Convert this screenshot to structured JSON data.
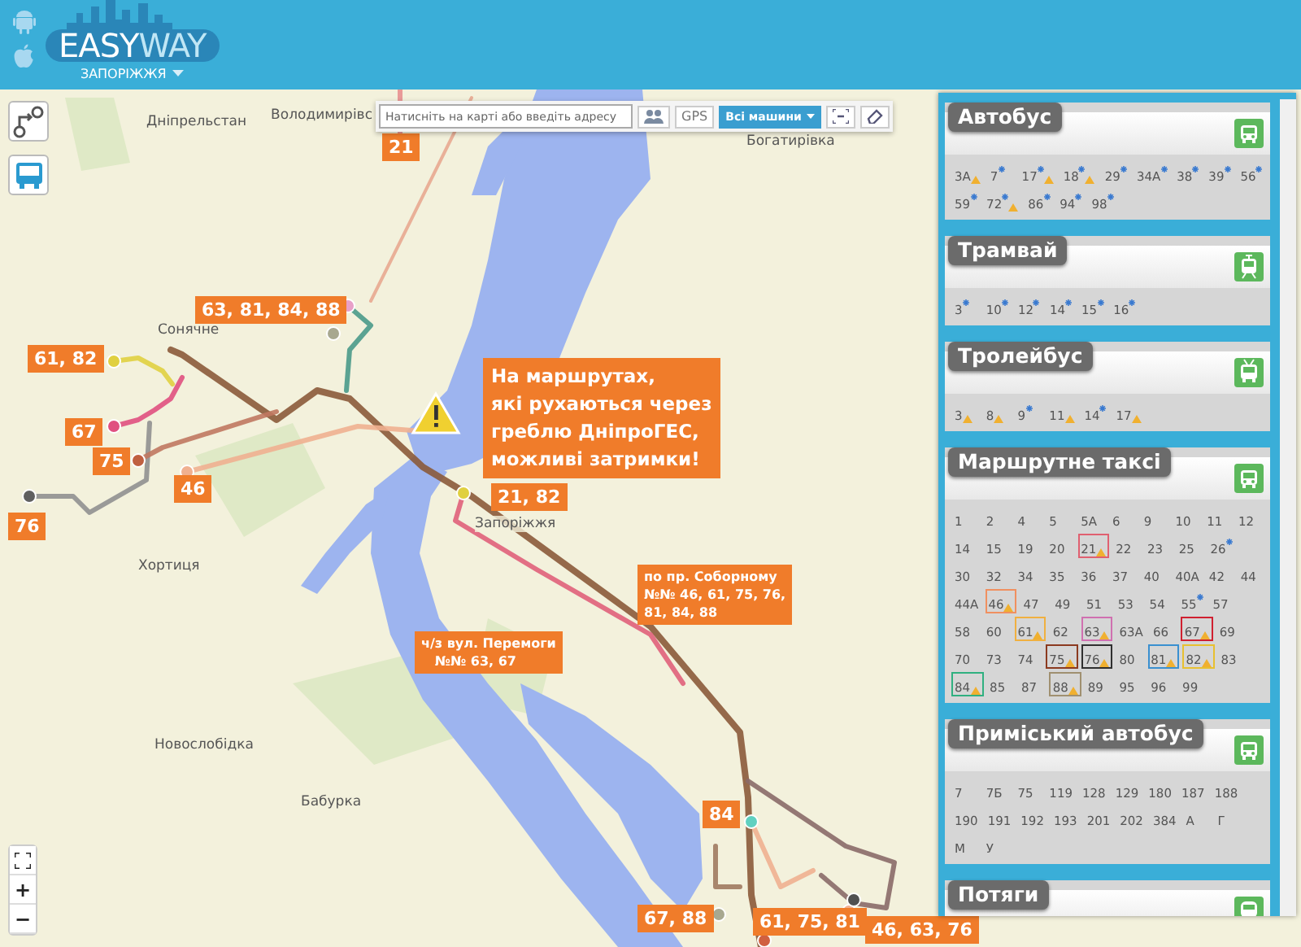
{
  "header": {
    "logo": [
      "EASY",
      "WAY"
    ],
    "city": "ЗАПОРІЖЖЯ"
  },
  "search": {
    "placeholder": "Натисніть на карті або введіть адресу",
    "gps": "GPS",
    "vehicles": "Всі машини"
  },
  "zoom": {
    "plus": "+",
    "minus": "−"
  },
  "map": {
    "places": [
      "Дніпрельстан",
      "Володимирівс",
      "Богатирівка",
      "Сонячне",
      "Хортиця",
      "Запоріжжя",
      "Новослобідка",
      "Бабурка"
    ],
    "route_labels": [
      "21",
      "63, 81, 84, 88",
      "61, 82",
      "67",
      "75",
      "46",
      "76",
      "21, 82",
      "84",
      "67, 88",
      "61, 75, 81",
      "46, 63, 76"
    ],
    "notes": [
      "по пр. Соборному\n№№ 46, 61, 75, 76,\n81, 84, 88",
      "ч/з вул. Перемоги\n   №№ 63, 67"
    ],
    "warning": "На маршрутах,\nякі рухаються через\nгреблю ДніпроГЕС,\nможливі затримки!"
  },
  "panel": {
    "sections": [
      {
        "title": "Автобус",
        "kind": "bus",
        "routes": [
          {
            "label": "3A",
            "star": false,
            "warning": true
          },
          {
            "label": "7",
            "star": true,
            "warning": false
          },
          {
            "label": "17",
            "star": true,
            "warning": true
          },
          {
            "label": "18",
            "star": true,
            "warning": true
          },
          {
            "label": "29",
            "star": true,
            "warning": false
          },
          {
            "label": "34A",
            "star": true,
            "warning": false
          },
          {
            "label": "38",
            "star": true,
            "warning": false
          },
          {
            "label": "39",
            "star": true,
            "warning": false
          },
          {
            "label": "56",
            "star": true,
            "warning": false
          },
          {
            "label": "59",
            "star": true,
            "warning": false
          },
          {
            "label": "72",
            "star": true,
            "warning": true
          },
          {
            "label": "86",
            "star": true,
            "warning": false
          },
          {
            "label": "94",
            "star": true,
            "warning": false
          },
          {
            "label": "98",
            "star": true,
            "warning": false
          }
        ]
      },
      {
        "title": "Трамвай",
        "kind": "tram",
        "routes": [
          {
            "label": "3",
            "star": true,
            "warning": false
          },
          {
            "label": "10",
            "star": true,
            "warning": false
          },
          {
            "label": "12",
            "star": true,
            "warning": false
          },
          {
            "label": "14",
            "star": true,
            "warning": false
          },
          {
            "label": "15",
            "star": true,
            "warning": false
          },
          {
            "label": "16",
            "star": true,
            "warning": false
          }
        ]
      },
      {
        "title": "Тролейбус",
        "kind": "trolleybus",
        "routes": [
          {
            "label": "3",
            "star": false,
            "warning": true
          },
          {
            "label": "8",
            "star": false,
            "warning": true
          },
          {
            "label": "9",
            "star": true,
            "warning": false
          },
          {
            "label": "11",
            "star": false,
            "warning": true
          },
          {
            "label": "14",
            "star": true,
            "warning": false
          },
          {
            "label": "17",
            "star": false,
            "warning": true
          }
        ]
      },
      {
        "title": "Маршрутне таксі",
        "kind": "bus",
        "routes": [
          {
            "label": "1",
            "star": false,
            "warning": false
          },
          {
            "label": "2",
            "star": false,
            "warning": false
          },
          {
            "label": "4",
            "star": false,
            "warning": false
          },
          {
            "label": "5",
            "star": false,
            "warning": false
          },
          {
            "label": "5A",
            "star": false,
            "warning": false
          },
          {
            "label": "6",
            "star": false,
            "warning": false
          },
          {
            "label": "9",
            "star": false,
            "warning": false
          },
          {
            "label": "10",
            "star": false,
            "warning": false
          },
          {
            "label": "11",
            "star": false,
            "warning": false
          },
          {
            "label": "12",
            "star": false,
            "warning": false
          },
          {
            "label": "14",
            "star": false,
            "warning": false
          },
          {
            "label": "15",
            "star": false,
            "warning": false
          },
          {
            "label": "19",
            "star": false,
            "warning": false
          },
          {
            "label": "20",
            "star": false,
            "warning": false
          },
          {
            "label": "21",
            "star": false,
            "warning": true,
            "color": "#e06070"
          },
          {
            "label": "22",
            "star": false,
            "warning": false
          },
          {
            "label": "23",
            "star": false,
            "warning": false
          },
          {
            "label": "25",
            "star": false,
            "warning": false
          },
          {
            "label": "26",
            "star": true,
            "warning": false
          },
          {
            "label": "30",
            "star": false,
            "warning": false
          },
          {
            "label": "32",
            "star": false,
            "warning": false
          },
          {
            "label": "34",
            "star": false,
            "warning": false
          },
          {
            "label": "35",
            "star": false,
            "warning": false
          },
          {
            "label": "36",
            "star": false,
            "warning": false
          },
          {
            "label": "37",
            "star": false,
            "warning": false
          },
          {
            "label": "40",
            "star": false,
            "warning": false
          },
          {
            "label": "40A",
            "star": false,
            "warning": false
          },
          {
            "label": "42",
            "star": false,
            "warning": false
          },
          {
            "label": "44",
            "star": false,
            "warning": false
          },
          {
            "label": "44A",
            "star": false,
            "warning": false
          },
          {
            "label": "46",
            "star": false,
            "warning": true,
            "color": "#f09060"
          },
          {
            "label": "47",
            "star": false,
            "warning": false
          },
          {
            "label": "49",
            "star": false,
            "warning": false
          },
          {
            "label": "51",
            "star": false,
            "warning": false
          },
          {
            "label": "53",
            "star": false,
            "warning": false
          },
          {
            "label": "54",
            "star": false,
            "warning": false
          },
          {
            "label": "55",
            "star": true,
            "warning": false
          },
          {
            "label": "57",
            "star": false,
            "warning": false
          },
          {
            "label": "58",
            "star": false,
            "warning": false
          },
          {
            "label": "60",
            "star": false,
            "warning": false
          },
          {
            "label": "61",
            "star": false,
            "warning": true,
            "color": "#f0b040"
          },
          {
            "label": "62",
            "star": false,
            "warning": false
          },
          {
            "label": "63",
            "star": false,
            "warning": true,
            "color": "#d070b0"
          },
          {
            "label": "63A",
            "star": false,
            "warning": false
          },
          {
            "label": "66",
            "star": false,
            "warning": false
          },
          {
            "label": "67",
            "star": false,
            "warning": true,
            "color": "#d02030"
          },
          {
            "label": "69",
            "star": false,
            "warning": false
          },
          {
            "label": "70",
            "star": false,
            "warning": false
          },
          {
            "label": "73",
            "star": false,
            "warning": false
          },
          {
            "label": "74",
            "star": false,
            "warning": false
          },
          {
            "label": "75",
            "star": false,
            "warning": true,
            "color": "#8b3a20"
          },
          {
            "label": "76",
            "star": false,
            "warning": true,
            "color": "#303030"
          },
          {
            "label": "80",
            "star": false,
            "warning": false
          },
          {
            "label": "81",
            "star": false,
            "warning": true,
            "color": "#3a90d0"
          },
          {
            "label": "82",
            "star": false,
            "warning": true,
            "color": "#e8c030"
          },
          {
            "label": "83",
            "star": false,
            "warning": false
          },
          {
            "label": "84",
            "star": false,
            "warning": true,
            "color": "#30b080"
          },
          {
            "label": "85",
            "star": false,
            "warning": false
          },
          {
            "label": "87",
            "star": false,
            "warning": false
          },
          {
            "label": "88",
            "star": false,
            "warning": true,
            "color": "#a09070"
          },
          {
            "label": "89",
            "star": false,
            "warning": false
          },
          {
            "label": "95",
            "star": false,
            "warning": false
          },
          {
            "label": "96",
            "star": false,
            "warning": false
          },
          {
            "label": "99",
            "star": false,
            "warning": false
          }
        ]
      },
      {
        "title": "Приміський автобус",
        "kind": "bus",
        "routes": [
          {
            "label": "7",
            "star": false,
            "warning": false
          },
          {
            "label": "7Б",
            "star": false,
            "warning": false
          },
          {
            "label": "75",
            "star": false,
            "warning": false
          },
          {
            "label": "119",
            "star": false,
            "warning": false
          },
          {
            "label": "128",
            "star": false,
            "warning": false
          },
          {
            "label": "129",
            "star": false,
            "warning": false
          },
          {
            "label": "180",
            "star": false,
            "warning": false
          },
          {
            "label": "187",
            "star": false,
            "warning": false
          },
          {
            "label": "188",
            "star": false,
            "warning": false
          },
          {
            "label": "190",
            "star": false,
            "warning": false
          },
          {
            "label": "191",
            "star": false,
            "warning": false
          },
          {
            "label": "192",
            "star": false,
            "warning": false
          },
          {
            "label": "193",
            "star": false,
            "warning": false
          },
          {
            "label": "201",
            "star": false,
            "warning": false
          },
          {
            "label": "202",
            "star": false,
            "warning": false
          },
          {
            "label": "384",
            "star": false,
            "warning": false
          },
          {
            "label": "А",
            "star": false,
            "warning": false
          },
          {
            "label": "Г",
            "star": false,
            "warning": false
          },
          {
            "label": "М",
            "star": false,
            "warning": false
          },
          {
            "label": "У",
            "star": false,
            "warning": false
          }
        ]
      },
      {
        "title": "Потяги",
        "kind": "train"
      }
    ]
  }
}
